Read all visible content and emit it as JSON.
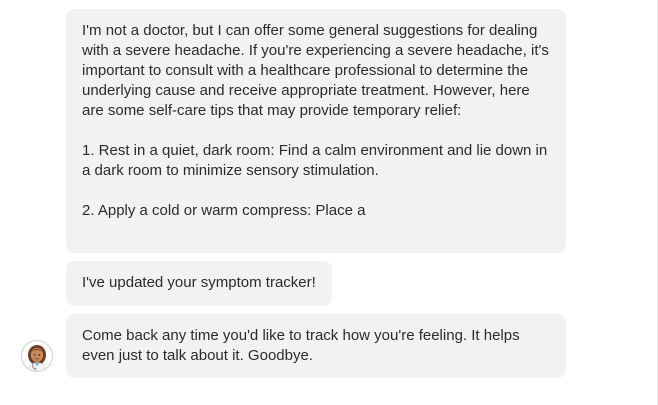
{
  "messages": [
    {
      "paragraphs": [
        "I'm not a doctor, but I can offer some general suggestions for dealing with a severe headache. If you're experiencing a severe headache, it's important to consult with a healthcare professional to determine the underlying cause and receive appropriate treatment. However, here are some self-care tips that may provide temporary relief:",
        "1. Rest in a quiet, dark room: Find a calm environment and lie down in a dark room to minimize sensory stimulation.",
        "2. Apply a cold or warm compress: Place a"
      ]
    },
    {
      "text": "I've updated your symptom tracker!"
    },
    {
      "text": "Come back any time you'd like to track how you're feeling. It helps even just to talk about it. Goodbye."
    }
  ],
  "avatar": {
    "icon": "health-worker-avatar-icon"
  },
  "colors": {
    "bubble_bg": "#f2f2f2",
    "text": "#2b2b2b"
  }
}
